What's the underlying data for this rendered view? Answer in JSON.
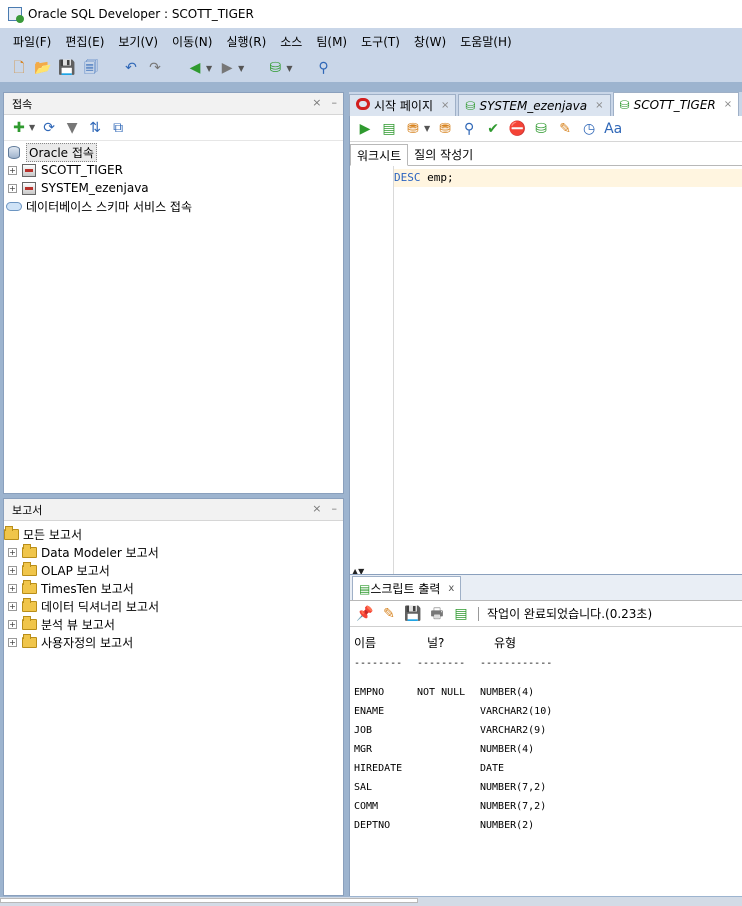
{
  "window": {
    "title": "Oracle SQL Developer : SCOTT_TIGER"
  },
  "menu": [
    "파일(F)",
    "편집(E)",
    "보기(V)",
    "이동(N)",
    "실행(R)",
    "소스",
    "팀(M)",
    "도구(T)",
    "창(W)",
    "도움말(H)"
  ],
  "toolbar": {
    "icons": [
      "new-file-icon",
      "open-folder-icon",
      "save-icon",
      "save-all-icon",
      "undo-icon",
      "redo-icon",
      "back-icon",
      "forward-icon",
      "sql-worksheet-icon",
      "find-icon"
    ]
  },
  "connections_panel": {
    "title": "접속",
    "header_buttons": {
      "close": "×",
      "minimize": "–"
    },
    "root": "Oracle 접속",
    "connections": [
      "SCOTT_TIGER",
      "SYSTEM_ezenjava"
    ],
    "cloud_item": "데이터베이스 스키마 서비스 접속"
  },
  "reports_panel": {
    "title": "보고서",
    "header_buttons": {
      "close": "×",
      "minimize": "–"
    },
    "root": "모든 보고서",
    "items": [
      "Data Modeler 보고서",
      "OLAP 보고서",
      "TimesTen 보고서",
      "데이터 딕셔너리 보고서",
      "분석 뷰 보고서",
      "사용자정의 보고서"
    ]
  },
  "editor_tabs": [
    {
      "label": "시작 페이지",
      "close": "×"
    },
    {
      "label": "SYSTEM_ezenjava",
      "close": "×"
    },
    {
      "label": "SCOTT_TIGER",
      "close": "×"
    }
  ],
  "editor": {
    "subtabs": [
      "워크시트",
      "질의 작성기"
    ],
    "code": {
      "keyword": "DESC",
      "rest": " emp;"
    },
    "splitter": "▲▼"
  },
  "output": {
    "tab_label": "스크립트 출력",
    "tab_close": "x",
    "status": "작업이 완료되었습니다.(0.23초)",
    "headers": [
      "이름",
      "널?",
      "유형"
    ],
    "dashes": [
      "--------",
      "--------",
      "------------"
    ],
    "rows": [
      [
        "EMPNO",
        "NOT NULL",
        "NUMBER(4)"
      ],
      [
        "ENAME",
        "",
        "VARCHAR2(10)"
      ],
      [
        "JOB",
        "",
        "VARCHAR2(9)"
      ],
      [
        "MGR",
        "",
        "NUMBER(4)"
      ],
      [
        "HIREDATE",
        "",
        "DATE"
      ],
      [
        "SAL",
        "",
        "NUMBER(7,2)"
      ],
      [
        "COMM",
        "",
        "NUMBER(7,2)"
      ],
      [
        "DEPTNO",
        "",
        "NUMBER(2)"
      ]
    ]
  },
  "colors": {
    "chrome": "#c9d6e8",
    "background": "#9db4cf",
    "keyword": "#2b64c0",
    "current_line": "#fff5e0"
  }
}
